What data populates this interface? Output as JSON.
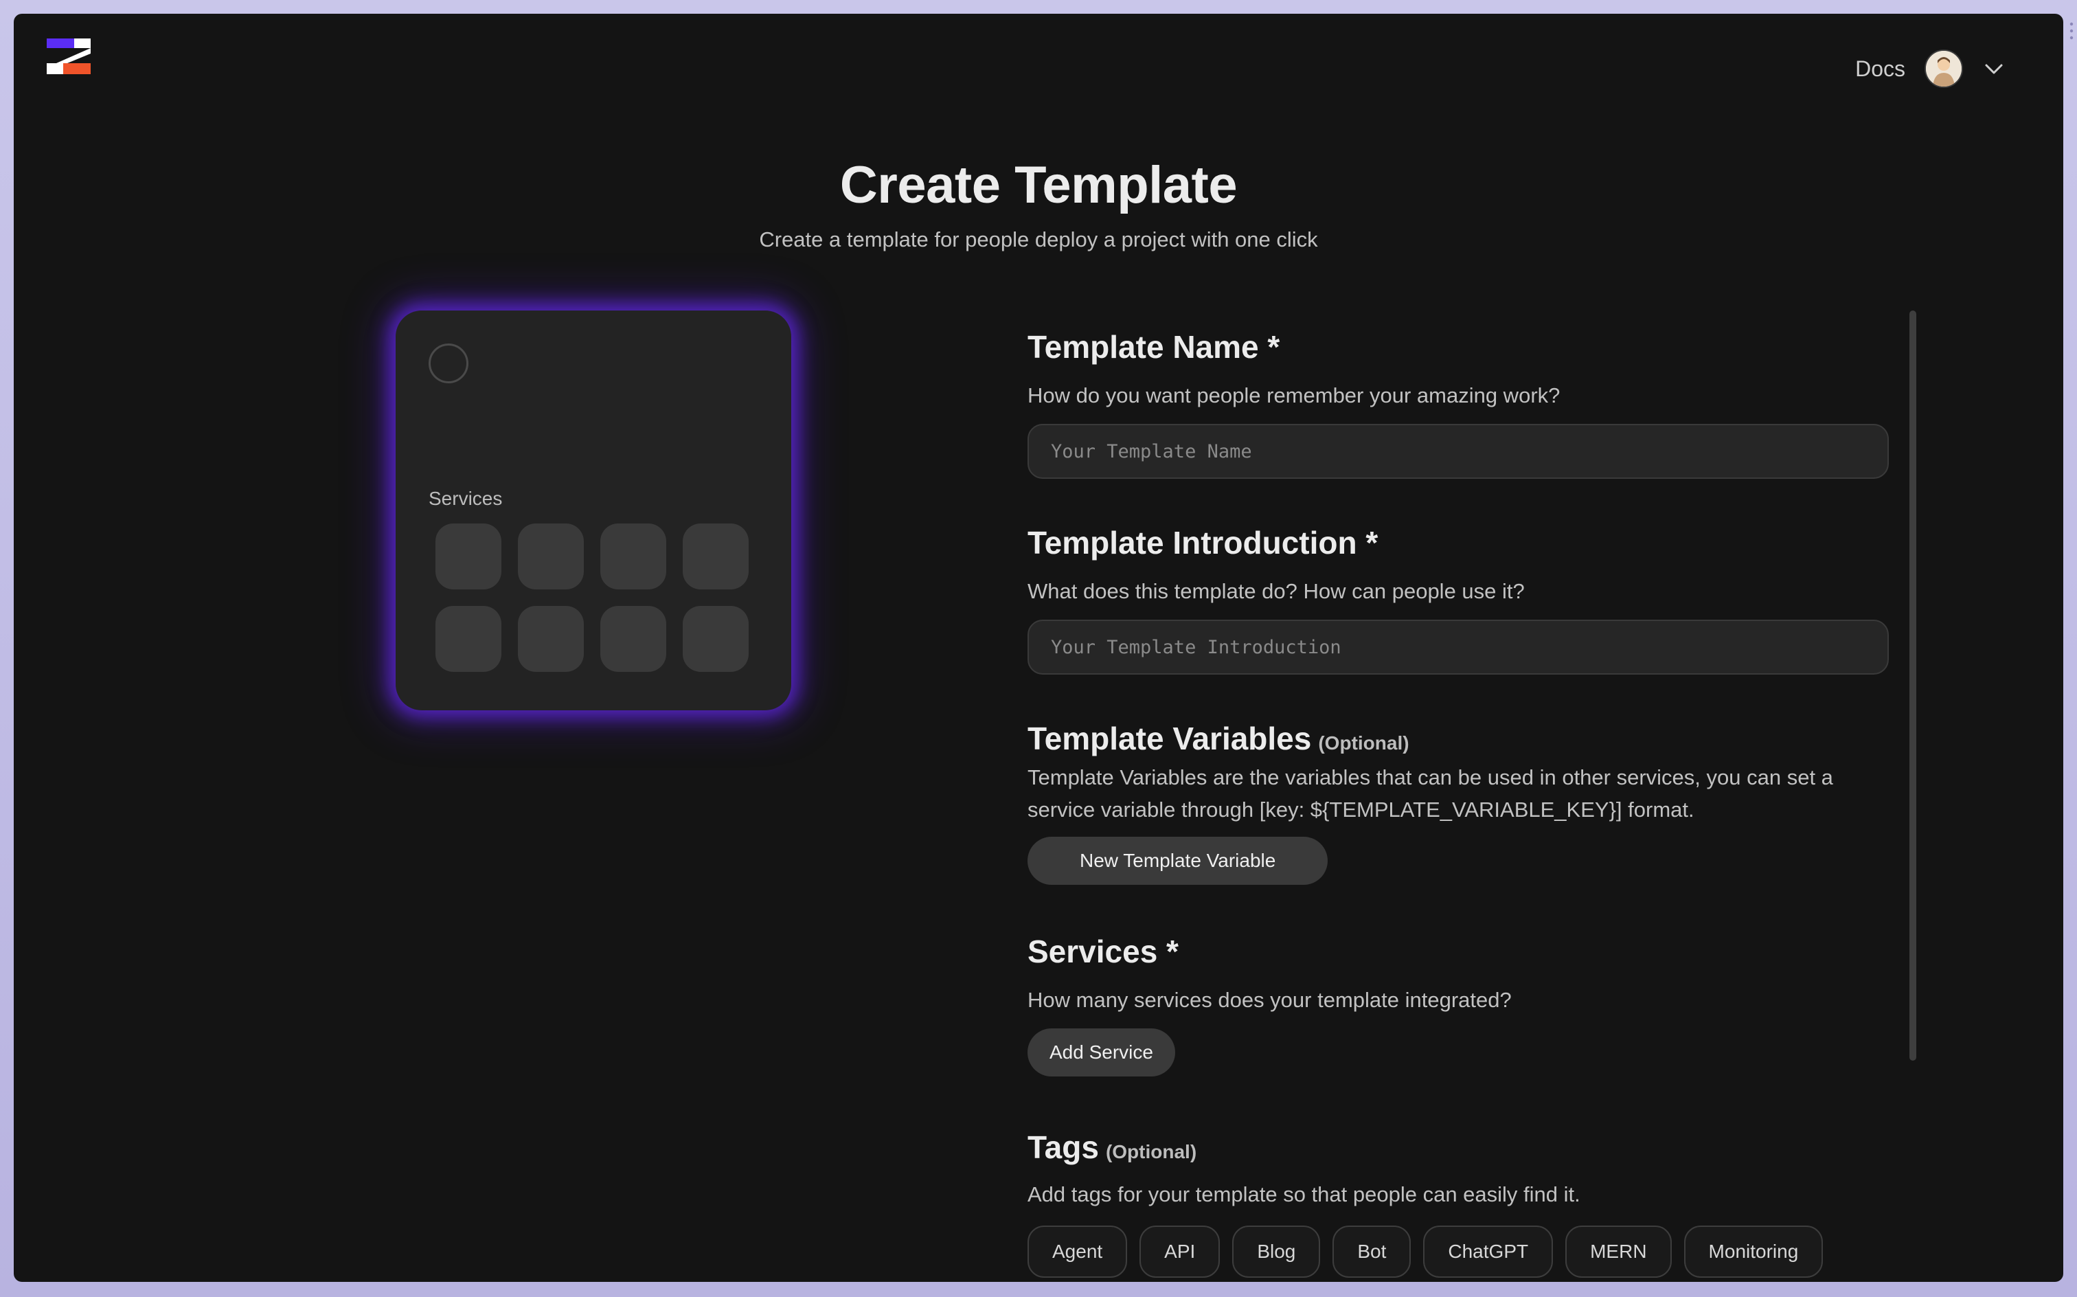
{
  "header": {
    "logo_icon": "zeabur-logo-icon",
    "docs_label": "Docs",
    "avatar_icon": "user-avatar-icon",
    "menu_icon": "chevron-down-icon"
  },
  "page": {
    "title": "Create Template",
    "subtitle": "Create a template for people deploy a project with one click"
  },
  "preview": {
    "services_label": "Services"
  },
  "form": {
    "name": {
      "title": "Template Name *",
      "description": "How do you want people remember your amazing work?",
      "placeholder": "Your Template Name",
      "value": ""
    },
    "introduction": {
      "title": "Template Introduction *",
      "description": "What does this template do? How can people use it?",
      "placeholder": "Your Template Introduction",
      "value": ""
    },
    "variables": {
      "title": "Template Variables",
      "optional": "(Optional)",
      "description": "Template Variables are the variables that can be used in other services, you can set a service variable through [key: ${TEMPLATE_VARIABLE_KEY}] format.",
      "button_label": "New Template Variable"
    },
    "services": {
      "title": "Services *",
      "description": "How many services does your template integrated?",
      "button_label": "Add Service"
    },
    "tags": {
      "title": "Tags",
      "optional": "(Optional)",
      "description": "Add tags for your template so that people can easily find it.",
      "items": [
        "Agent",
        "API",
        "Blog",
        "Bot",
        "ChatGPT",
        "MERN",
        "Monitoring"
      ]
    }
  },
  "colors": {
    "background": "#141414",
    "card_glow": "#6228e6",
    "logo_purple": "#5b2df5",
    "logo_orange": "#f0542a"
  }
}
